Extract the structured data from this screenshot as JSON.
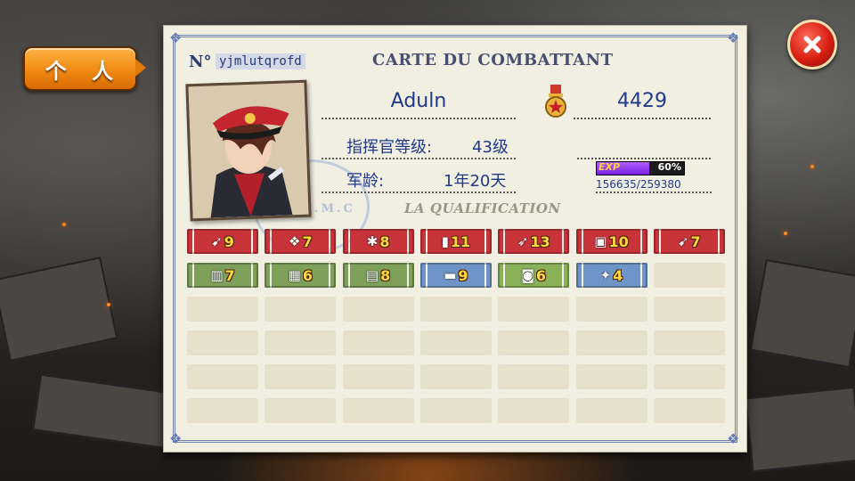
{
  "tab": {
    "label": "个 人"
  },
  "close": {
    "icon": "close-icon"
  },
  "card": {
    "no_label": "N°",
    "player_id": "yjmlutqrofd",
    "title": "CARTE DU COMBATTANT",
    "name": "Aduln",
    "points": "4429",
    "level_label": "指挥官等级:",
    "level_value": "43级",
    "age_label": "军龄:",
    "age_value": "1年20天",
    "exp_tag": "EXP",
    "exp_percent": "60%",
    "exp_progress": 0.6,
    "exp_numbers": "156635/259380",
    "qualification": "LA QUALIFICATION",
    "stamp_text": "A.M.C"
  },
  "badges": [
    {
      "name": "bullet-badge",
      "icon": "bullet-icon",
      "count": "9",
      "color": "#c8343a"
    },
    {
      "name": "shell-badge",
      "icon": "shell-icon",
      "count": "7",
      "color": "#c8343a"
    },
    {
      "name": "grenade-badge",
      "icon": "grenade-icon",
      "count": "8",
      "color": "#c8343a"
    },
    {
      "name": "cannon-shell-badge",
      "icon": "cannon-shell-icon",
      "count": "11",
      "color": "#c8343a"
    },
    {
      "name": "rocket-badge",
      "icon": "rocket-icon",
      "count": "13",
      "color": "#c8343a"
    },
    {
      "name": "fuel-badge",
      "icon": "fuel-icon",
      "count": "10",
      "color": "#c8343a"
    },
    {
      "name": "ammo-badge",
      "icon": "ammo-icon",
      "count": "7",
      "color": "#c8343a"
    },
    {
      "name": "building-badge",
      "icon": "building-icon",
      "count": "7",
      "color": "#7ea05a"
    },
    {
      "name": "fortress-badge",
      "icon": "fortress-icon",
      "count": "6",
      "color": "#7ea05a"
    },
    {
      "name": "bunker-badge",
      "icon": "bunker-icon",
      "count": "8",
      "color": "#7ea05a"
    },
    {
      "name": "tank-badge",
      "icon": "tank-icon",
      "count": "9",
      "color": "#6f94c8"
    },
    {
      "name": "supply-badge",
      "icon": "supply-icon",
      "count": "6",
      "color": "#8ab05a"
    },
    {
      "name": "lightbulb-badge",
      "icon": "lightbulb-icon",
      "count": "4",
      "color": "#6f94c8"
    }
  ]
}
